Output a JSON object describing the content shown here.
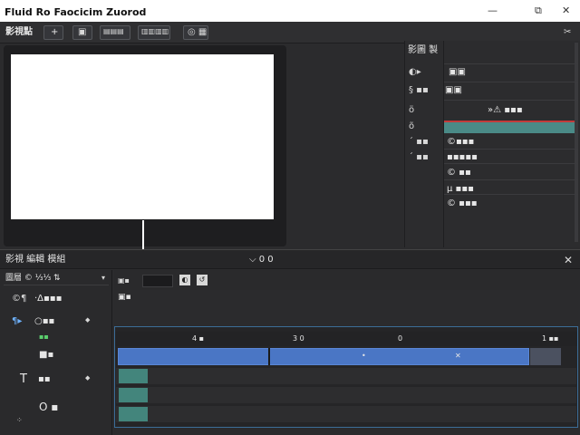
{
  "window": {
    "title": "Fluid Ro Faocicim Zuorod",
    "buttons": {
      "minimize": "—",
      "maximize": "⧉",
      "close": "✕"
    }
  },
  "toolbar": {
    "menu_label": "影視點",
    "add": "+",
    "btn2": "▣",
    "btn3": "▤▤▤",
    "btn4": "▥▥▥▥",
    "btn5": "◎ ▦",
    "wrench": "✂"
  },
  "properties": {
    "header": "影圖 製",
    "rows": [
      {
        "icon": "◐▸",
        "value": "▣▣"
      },
      {
        "icon": "§ ▪▪",
        "value": "▣▣"
      },
      {
        "icon": "ö",
        "value": "»⚠ ▪▪▪"
      },
      {
        "icon": "õ",
        "value": "©▪▪▪"
      },
      {
        "icon": "´ ▪▪",
        "value": "▪▪▪▪▪"
      },
      {
        "icon": "´ ▪▪",
        "value": "© ▪▪"
      },
      {
        "icon": "",
        "value": "µ ▪▪▪"
      },
      {
        "icon": "",
        "value": "© ▪▪▪"
      }
    ]
  },
  "timeline": {
    "header_label": "影視 編輯 模組",
    "center_label": "⌵ 0 0",
    "close": "✕",
    "left_header": "圖層 © ⅓⅓ ⇅",
    "left_dropdown": "▾",
    "layers": [
      {
        "icon": "©¶",
        "name": "·Δ▪▪▪",
        "extra": ""
      },
      {
        "icon": "¶▸",
        "name": "○▪▪",
        "extra": "◆"
      },
      {
        "icon": "",
        "name": "▪▪",
        "extra": ""
      },
      {
        "icon": "",
        "name": "■▪",
        "extra": ""
      },
      {
        "icon": "T",
        "name": "▪▪",
        "extra": "◆"
      },
      {
        "icon": "",
        "name": "O ▪",
        "extra": ""
      },
      {
        "icon": "⁘",
        "name": "",
        "extra": ""
      }
    ],
    "controls_label": "▣▪",
    "ruler_ticks": [
      "4 ▪",
      "3 0",
      "0",
      "1 ▪▪"
    ],
    "clip_markers": [
      "•",
      "✕"
    ]
  }
}
